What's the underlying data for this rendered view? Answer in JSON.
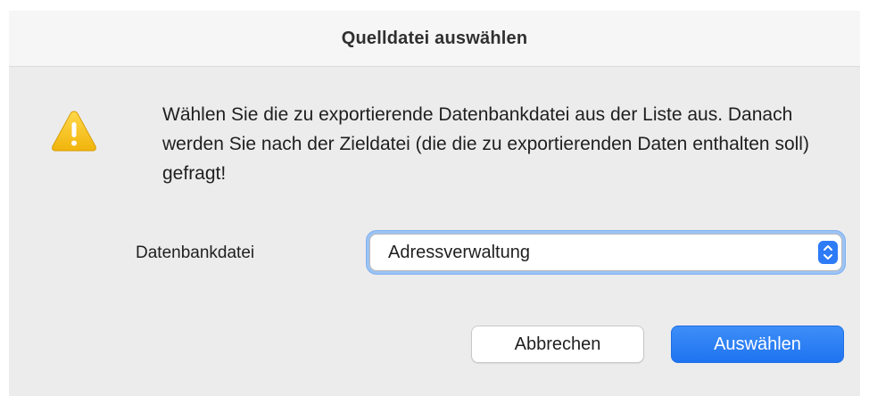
{
  "dialog": {
    "title": "Quelldatei auswählen",
    "icon": "warning-icon",
    "message": "Wählen Sie die zu exportierende Datenbankdatei aus der Liste aus. Danach werden Sie nach der Zieldatei (die die zu exportierenden Daten enthalten soll) gefragt!",
    "field": {
      "label": "Datenbankdatei",
      "selected_value": "Adressverwaltung",
      "stepper_icon": "up-down-chevron-icon"
    },
    "buttons": {
      "cancel_label": "Abbrechen",
      "ok_label": "Auswählen"
    }
  },
  "colors": {
    "accent": "#2d7bf6",
    "warning": "#f7c21a",
    "dialog_bg": "#ececec"
  }
}
